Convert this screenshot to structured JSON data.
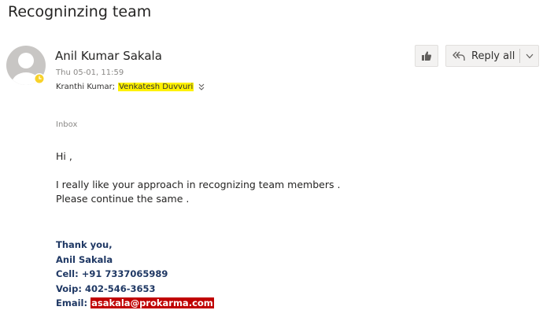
{
  "message": {
    "subject": "Recogninzing team",
    "sender": {
      "name": "Anil Kumar Sakala",
      "sent_time": "Thu 05-01, 11:59",
      "avatar_icon": "person-avatar-icon",
      "presence_icon": "away-clock-icon",
      "presence_color": "#f8d22a"
    },
    "recipients": [
      {
        "name": "Kranthi Kumar",
        "highlighted": false
      },
      {
        "name": "Venkatesh Duvvuri",
        "highlighted": true
      }
    ],
    "recipient_separator": ";",
    "expand_icon": "chevron-double-down-icon",
    "folder": "Inbox"
  },
  "actions": {
    "like_icon": "thumbs-up-icon",
    "reply_all_label": "Reply all",
    "reply_all_icon": "reply-all-icon",
    "more_icon": "chevron-down-icon"
  },
  "body": {
    "greeting": "Hi ,",
    "line1": "I really like your approach in recognizing team members .",
    "line2": "Please continue the same ."
  },
  "signature": {
    "closing": "Thank you,",
    "name": "Anil Sakala",
    "cell": "Cell: +91 7337065989",
    "voip": "Voip: 402-546-3653",
    "email_label": "Email: ",
    "email": "asakala@prokarma.com"
  },
  "colors": {
    "highlight": "#fff200",
    "signature": "#1f3864",
    "email_highlight": "#c00000"
  }
}
